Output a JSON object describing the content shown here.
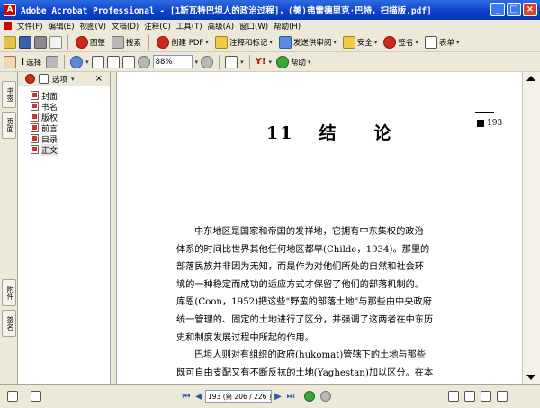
{
  "window": {
    "title": "Adobe Acrobat Professional - [1斯瓦特巴坦人的政治过程]，(美)弗雷德里克·巴特，扫描版.pdf]",
    "app_icon_letter": "A"
  },
  "menu": [
    {
      "label": "文件(F)"
    },
    {
      "label": "编辑(E)"
    },
    {
      "label": "视图(V)"
    },
    {
      "label": "文档(D)"
    },
    {
      "label": "注释(C)"
    },
    {
      "label": "工具(T)"
    },
    {
      "label": "高级(A)"
    },
    {
      "label": "窗口(W)"
    },
    {
      "label": "帮助(H)"
    }
  ],
  "toolbar1": {
    "search_label": "搜索",
    "create_pdf": "创建 PDF",
    "comment_markup": "注释和标记",
    "send_review": "发送供审阅",
    "secure": "安全",
    "sign": "签名",
    "forms": "表单",
    "organizer_label": "图整"
  },
  "toolbar2": {
    "select_label": "选择",
    "zoom_value": "88%",
    "yahoo_label": "Y!",
    "help_label": "帮助"
  },
  "nav_tabs": {
    "bookmarks": "书签",
    "pages": "页面",
    "signatures": "签名",
    "layers": "附件"
  },
  "bookmarks_panel": {
    "options_label": "选项",
    "items": [
      {
        "label": "封面"
      },
      {
        "label": "书名"
      },
      {
        "label": "版权"
      },
      {
        "label": "前言"
      },
      {
        "label": "目录"
      },
      {
        "label": "正文"
      }
    ]
  },
  "document": {
    "chapter_num": "11",
    "chapter_char1": "结",
    "chapter_char2": "论",
    "page_number": "193",
    "para1": [
      "中东地区是国家和帝国的发祥地，它拥有中东集权的政治",
      "体系的时间比世界其他任何地区都早(Childe，1934)。那里的",
      "部落民族并非因为无知，而是作为对他们所处的自然和社会环",
      "境的一种稳定而成功的适应方式才保留了他们的部落机制的。",
      "库恩(Coon，1952)把这些\"野蛮的部落土地\"与那些由中央政府",
      "统一管理的、固定的土地进行了区分，并强调了这两者在中东历",
      "史和制度发展过程中所起的作用。"
    ],
    "para2": [
      "巴坦人则对有组织的政府(hukomat)管辖下的土地与那些",
      "既可自由支配又有不断反抗的土地(Yaghestan)加以区分。在本"
    ]
  },
  "statusbar": {
    "page_field": "193 (第 206 / 226 页)"
  }
}
